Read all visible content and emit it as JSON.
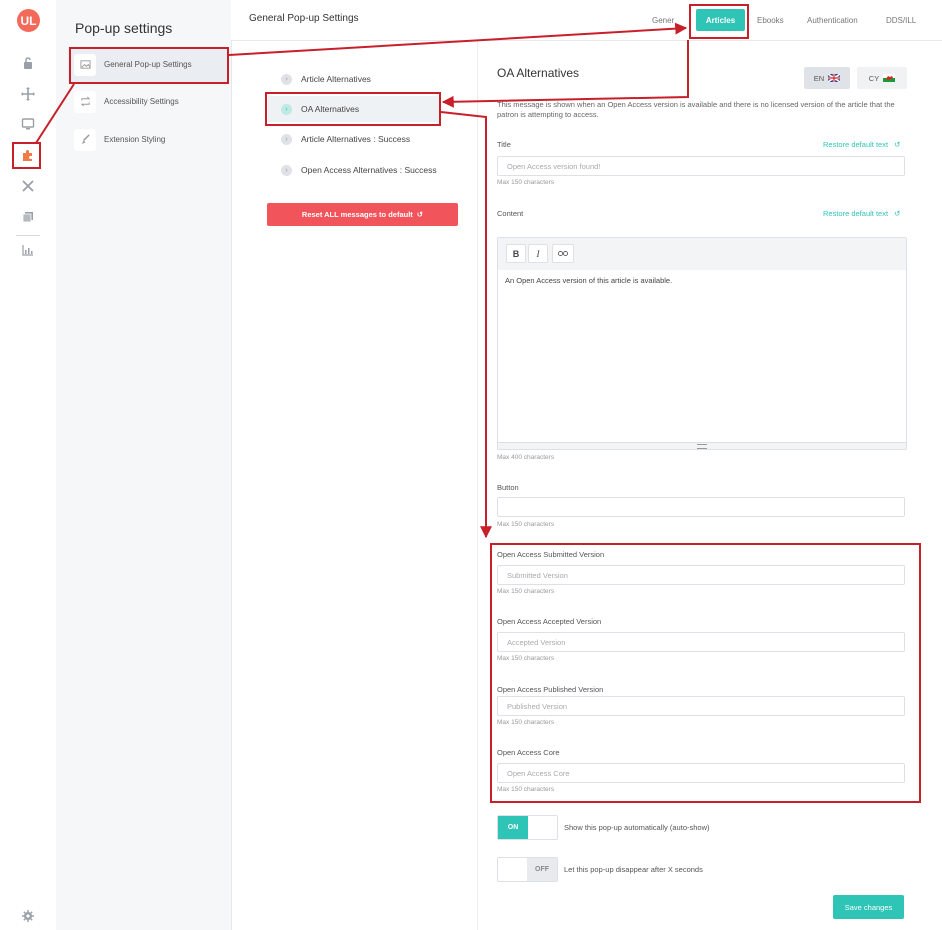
{
  "app": {
    "logo_text": "UL"
  },
  "rail": {
    "icons": [
      "lock-icon",
      "move-icon",
      "monitor-icon",
      "puzzle-icon",
      "tools-icon",
      "copy-icon",
      "chart-icon",
      "gear-icon"
    ]
  },
  "sidebar": {
    "title": "Pop-up settings",
    "items": [
      {
        "label": "General Pop-up Settings"
      },
      {
        "label": "Accessibility Settings"
      },
      {
        "label": "Extension Styling"
      }
    ]
  },
  "header": {
    "title": "General Pop-up Settings",
    "tabs": [
      {
        "label": "Gener"
      },
      {
        "label": "Articles"
      },
      {
        "label": "Ebooks"
      },
      {
        "label": "Authentication"
      },
      {
        "label": "DDS/ILL"
      }
    ]
  },
  "messages": {
    "items": [
      {
        "label": "Article Alternatives"
      },
      {
        "label": "OA Alternatives"
      },
      {
        "label": "Article Alternatives : Success"
      },
      {
        "label": "Open Access Alternatives : Success"
      }
    ],
    "reset_label": "Reset ALL messages to default"
  },
  "form": {
    "heading": "OA Alternatives",
    "lang_en": "EN",
    "lang_cy": "CY",
    "description": "This message is shown when an Open Access version is available and there is no licensed version of the article that the patron is attempting to access.",
    "restore_label": "Restore default text",
    "title_label": "Title",
    "title_placeholder": "Open Access version found!",
    "title_hint": "Max 150 characters",
    "content_label": "Content",
    "content_text": "An Open Access version of this article is available.",
    "content_hint": "Max 400 characters",
    "button_label": "Button",
    "button_hint": "Max 150 characters",
    "submitted_label": "Open Access Submitted Version",
    "submitted_placeholder": "Submitted Version",
    "submitted_hint": "Max 150 characters",
    "accepted_label": "Open Access Accepted Version",
    "accepted_placeholder": "Accepted Version",
    "accepted_hint": "Max 150 characters",
    "published_label": "Open Access Published Version",
    "published_placeholder": "Published Version",
    "published_hint": "Max 150 characters",
    "core_label": "Open Access Core",
    "core_placeholder": "Open Access Core",
    "core_hint": "Max 150 characters",
    "autoshow_state": "ON",
    "autoshow_label": "Show this pop-up automatically (auto-show)",
    "disappear_state": "OFF",
    "disappear_label": "Let this pop-up disappear after X seconds",
    "save_label": "Save changes"
  },
  "colors": {
    "accent": "#2ec4b6",
    "danger": "#f2545b",
    "logo": "#f46a5a",
    "annotation": "#c8202a"
  }
}
